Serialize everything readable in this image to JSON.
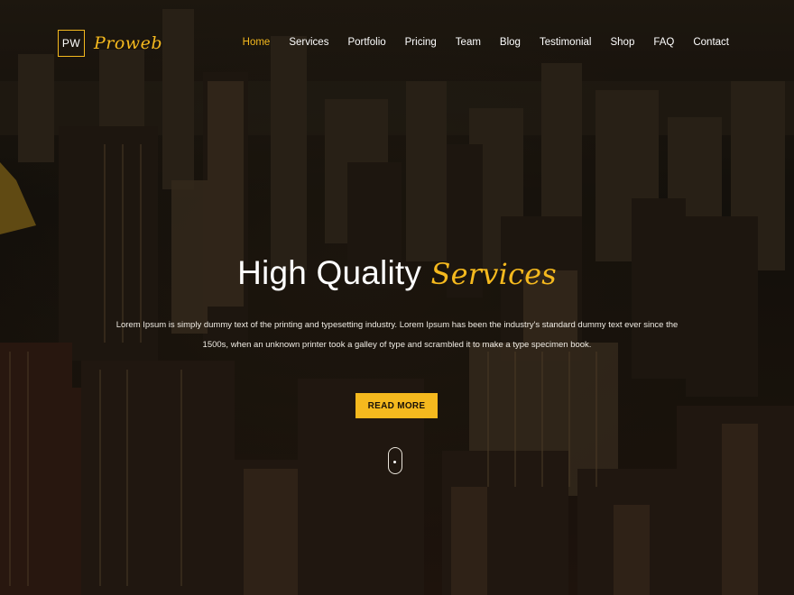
{
  "header": {
    "logo_mark": "PW",
    "logo_name": "Proweb",
    "nav": [
      {
        "label": "Home",
        "active": true
      },
      {
        "label": "Services",
        "active": false
      },
      {
        "label": "Portfolio",
        "active": false
      },
      {
        "label": "Pricing",
        "active": false
      },
      {
        "label": "Team",
        "active": false
      },
      {
        "label": "Blog",
        "active": false
      },
      {
        "label": "Testimonial",
        "active": false
      },
      {
        "label": "Shop",
        "active": false
      },
      {
        "label": "FAQ",
        "active": false
      },
      {
        "label": "Contact",
        "active": false
      }
    ]
  },
  "hero": {
    "title_plain": "High Quality",
    "title_accent": "Services",
    "description": "Lorem Ipsum is simply dummy text of the printing and typesetting industry. Lorem Ipsum has been the industry's standard dummy text ever since the 1500s, when an unknown printer took a galley of type and scrambled it to make a type specimen book.",
    "button_label": "READ MORE"
  },
  "colors": {
    "accent": "#f5b91e",
    "text": "#ffffff"
  },
  "icons": {
    "scroll": "mouse-scroll-icon"
  }
}
